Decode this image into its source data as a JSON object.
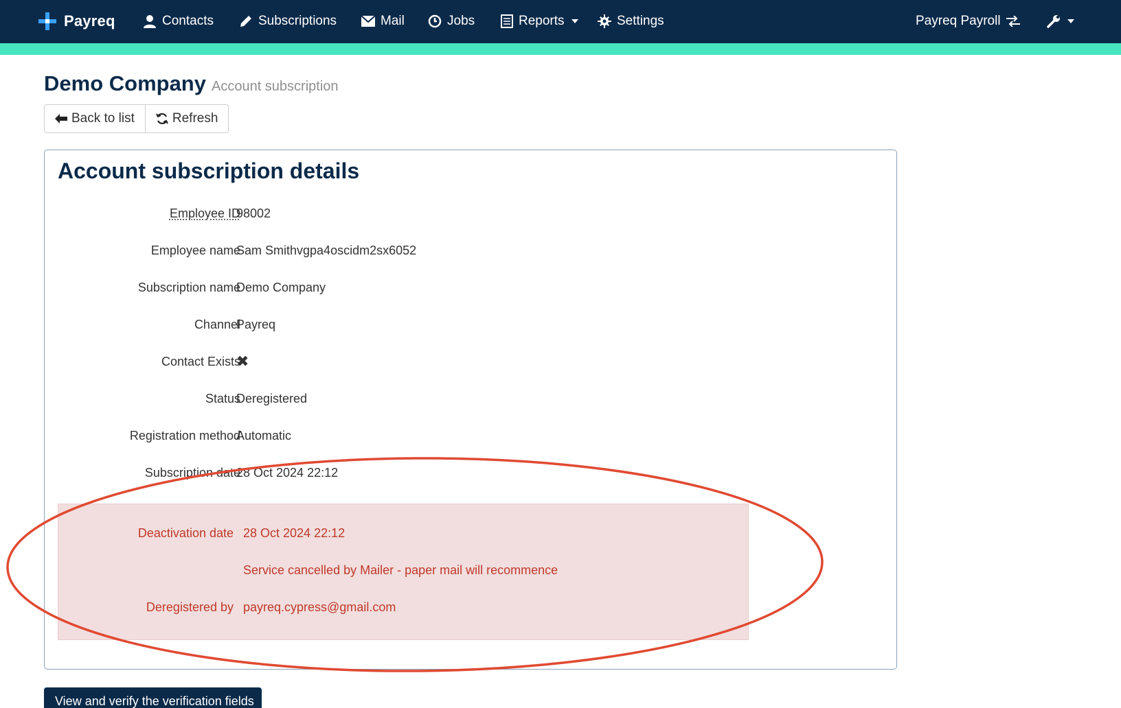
{
  "nav": {
    "brand": "Payreq",
    "items": [
      {
        "label": "Contacts",
        "icon": "user-icon"
      },
      {
        "label": "Subscriptions",
        "icon": "pencil-icon"
      },
      {
        "label": "Mail",
        "icon": "envelope-icon"
      },
      {
        "label": "Jobs",
        "icon": "clock-icon"
      },
      {
        "label": "Reports",
        "icon": "report-icon"
      },
      {
        "label": "Settings",
        "icon": "gear-icon"
      }
    ],
    "account": "Payreq Payroll"
  },
  "colors": {
    "navbar": "#0b2a4a",
    "accent": "#45e6be",
    "danger_bg": "#f2dede",
    "danger_text": "#c0392b",
    "annotation": "#e04a32"
  },
  "header": {
    "title": "Demo Company",
    "subtitle": "Account subscription"
  },
  "actions": {
    "back": "Back to list",
    "refresh": "Refresh"
  },
  "panel": {
    "title": "Account subscription details",
    "fields": [
      {
        "label": "Employee ID",
        "value": "98002"
      },
      {
        "label": "Employee name",
        "value": "Sam Smithvgpa4oscidm2sx6052"
      },
      {
        "label": "Subscription name",
        "value": "Demo Company"
      },
      {
        "label": "Channel",
        "value": "Payreq"
      },
      {
        "label": "Contact Exists",
        "value": "✖"
      },
      {
        "label": "Status",
        "value": "Deregistered"
      },
      {
        "label": "Registration method",
        "value": "Automatic"
      },
      {
        "label": "Subscription date",
        "value": "28 Oct 2024 22:12"
      }
    ],
    "deactivation": [
      {
        "label": "Deactivation date",
        "value": "28 Oct 2024 22:12"
      },
      {
        "label": "",
        "value": "Service cancelled by Mailer - paper mail will recommence"
      },
      {
        "label": "Deregistered by",
        "value": "payreq.cypress@gmail.com"
      }
    ]
  },
  "bottom_button": "View and verify the verification fields"
}
